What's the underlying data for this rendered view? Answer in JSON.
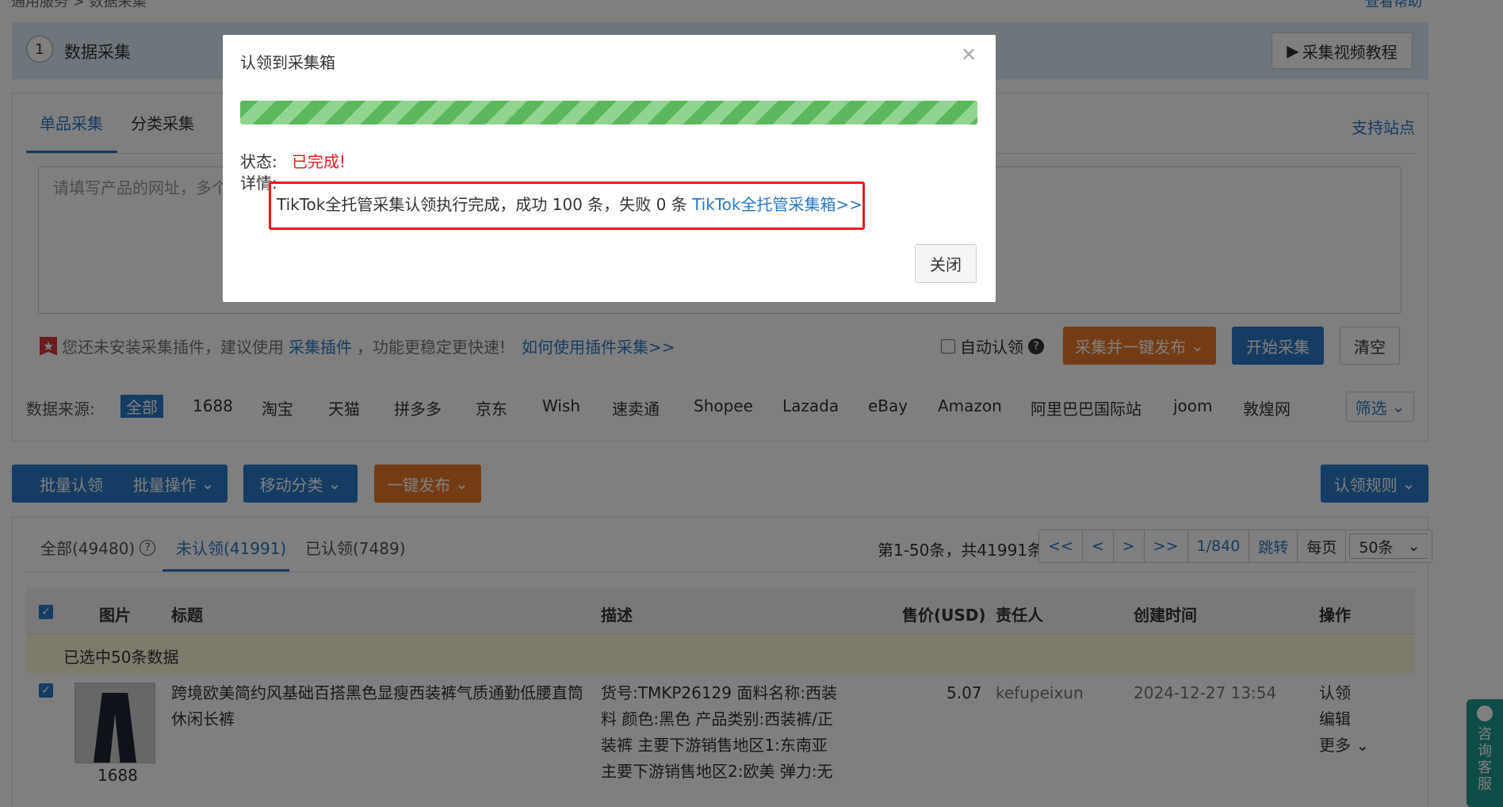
{
  "breadcrumb": {
    "parent": "通用服务",
    "current": "数据采集"
  },
  "help_link": "查看帮助",
  "step": {
    "number": "1",
    "title": "数据采集",
    "video_button": "采集视频教程"
  },
  "tabs": [
    "单品采集",
    "分类采集"
  ],
  "support_sites": "支持站点",
  "url_placeholder": "请填写产品的网址，多个",
  "plugin_tip": {
    "prefix": "您还未安装采集插件，建议使用",
    "link1": "采集插件",
    "middle": "，功能更稳定更快速!",
    "link2": "如何使用插件采集>>"
  },
  "collect_actions": {
    "auto_claim": "自动认领",
    "publish": "采集并一键发布",
    "start": "开始采集",
    "clear": "清空"
  },
  "source": {
    "label": "数据来源:",
    "items": [
      "全部",
      "1688",
      "淘宝",
      "天猫",
      "拼多多",
      "京东",
      "Wish",
      "速卖通",
      "Shopee",
      "Lazada",
      "eBay",
      "Amazon",
      "阿里巴巴国际站",
      "joom",
      "敦煌网"
    ],
    "filter": "筛选"
  },
  "toolbar": {
    "batch_claim": "批量认领",
    "batch_ops": "批量操作",
    "move_category": "移动分类",
    "one_click_publish": "一键发布",
    "claim_rules": "认领规则"
  },
  "list_tabs": {
    "all": "全部(49480)",
    "unclaimed": "未认领(41991)",
    "claimed": "已认领(7489)"
  },
  "pagination": {
    "info": "第1-50条，共41991条",
    "first": "<<",
    "prev": "<",
    "next": ">",
    "last": ">>",
    "page": "1/840",
    "jump": "跳转",
    "per_page_label": "每页",
    "per_page": "50条"
  },
  "table": {
    "headers": {
      "image": "图片",
      "title": "标题",
      "desc": "描述",
      "price": "售价(USD)",
      "owner": "责任人",
      "created": "创建时间",
      "ops": "操作"
    },
    "selected_text": "已选中50条数据",
    "rows": [
      {
        "source": "1688",
        "title_l1": "跨境欧美简约风基础百搭黑色显瘦西装裤气质通勤低腰直筒",
        "title_l2": "休闲长裤",
        "desc_l1": "货号:TMKP26129 面料名称:西装",
        "desc_l2": "料 颜色:黑色 产品类别:西装裤/正",
        "desc_l3": "装裤 主要下游销售地区1:东南亚",
        "desc_l4": "主要下游销售地区2:欧美 弹力:无",
        "price": "5.07",
        "owner": "kefupeixun",
        "created": "2024-12-27 13:54",
        "op_claim": "认领",
        "op_edit": "编辑",
        "op_more": "更多"
      }
    ]
  },
  "side_service": [
    "咨",
    "询",
    "客",
    "服"
  ],
  "modal": {
    "title": "认领到采集箱",
    "status_label": "状态:",
    "status_value": "已完成!",
    "detail_label": "详情:",
    "detail_text": "TikTok全托管采集认领执行完成，成功 100 条，失败 0 条",
    "detail_link": "TikTok全托管采集箱>>",
    "close_button": "关闭",
    "progress": 1.0
  }
}
